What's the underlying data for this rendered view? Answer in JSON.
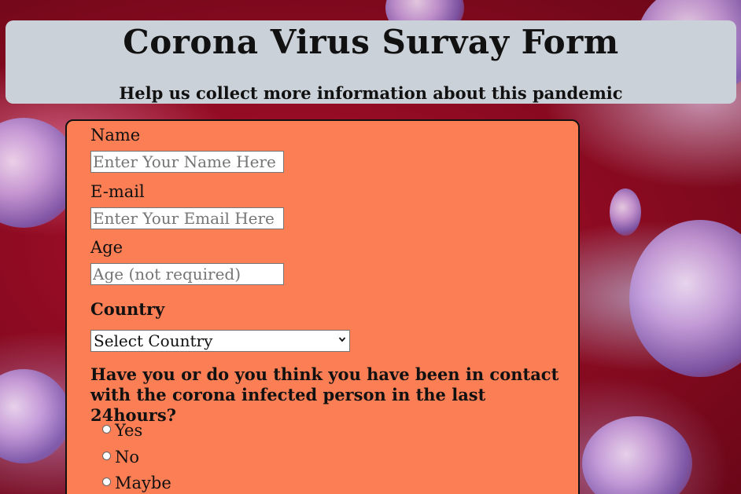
{
  "header": {
    "title": "Corona Virus Survay Form",
    "subtitle": "Help us collect more information about this pandemic"
  },
  "form": {
    "name": {
      "label": "Name",
      "placeholder": "Enter Your Name Here",
      "value": ""
    },
    "email": {
      "label": "E-mail",
      "placeholder": "Enter Your Email Here",
      "value": ""
    },
    "age": {
      "label": "Age",
      "placeholder": "Age (not required)",
      "value": ""
    },
    "country": {
      "label": "Country",
      "selected": "Select Country"
    },
    "contact_question": "Have you or do you think you have been in contact with the corona infected person in the last 24hours?",
    "options": [
      "Yes",
      "No",
      "Maybe"
    ]
  },
  "icons": {
    "select_arrow": "chevron-down-icon"
  },
  "colors": {
    "form_background": "#fb7e54",
    "header_background": "#cbd1d8",
    "page_background": "#8f0b22"
  }
}
